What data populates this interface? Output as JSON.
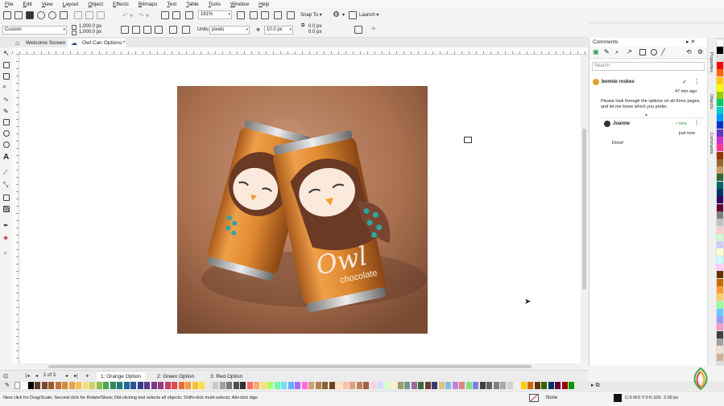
{
  "menu": [
    "File",
    "Edit",
    "View",
    "Layout",
    "Object",
    "Effects",
    "Bitmaps",
    "Text",
    "Table",
    "Tools",
    "Window",
    "Help"
  ],
  "toolbar": {
    "zoom": "161%",
    "snap_to": "Snap To",
    "launch": "Launch"
  },
  "propbar": {
    "preset": "Custom",
    "width": "1,000.0 px",
    "height": "1,000.0 px",
    "units_label": "Units:",
    "units": "pixels",
    "nudge": "10.0 px",
    "dup_x": "0.0 px",
    "dup_y": "0.0 px"
  },
  "doc_tabs": [
    {
      "label": "Welcome Screen",
      "icon": "home-icon",
      "active": false
    },
    {
      "label": "Owl Can Options.*",
      "icon": "doc-icon",
      "active": true
    }
  ],
  "page_nav": {
    "counter": "1 of 3",
    "pages": [
      "1: Orange Option",
      "2: Green Option",
      "3: Red Option"
    ],
    "active_index": 0
  },
  "comments_panel": {
    "title": "Comments",
    "search_placeholder": "Search",
    "thread": {
      "author": "bonnie roskes",
      "time": "47 min ago",
      "body": "Please look through the options on all three pages, and let me know which you prefer.",
      "reply": {
        "author": "Joanne",
        "badge": "• new",
        "time": "just now",
        "body": "Done!"
      }
    }
  },
  "side_tabs": [
    "Properties",
    "Objects",
    "Comments"
  ],
  "status": {
    "hint": "Next click for Drag/Scale; Second click for Rotate/Skew; Dbl-clicking tool selects all objects; Shift+click multi-selects; Alt+click digs",
    "fill": "None",
    "outline_color": "C:0 M:0 Y:0 K:100",
    "outline_width": "2.00 px"
  },
  "artwork": {
    "brand_script": "Owl",
    "brand_word": "chocolate",
    "background_color": "#b47c5c",
    "can_color": "#d9852a"
  },
  "palette_colors": [
    "#ffffff",
    "#000000",
    "#5a3a26",
    "#7a4a2e",
    "#9a5d32",
    "#c0753a",
    "#d68a3c",
    "#e5a44c",
    "#f0c25a",
    "#f7dc7a",
    "#c8d45a",
    "#8fbf4a",
    "#4aa84a",
    "#2e8a5a",
    "#1d7a7a",
    "#1b6a9a",
    "#2c4f9a",
    "#3a3a8a",
    "#5a3a8a",
    "#7a3a8a",
    "#9a3a7a",
    "#c0406a",
    "#e04a4a",
    "#f06a3a",
    "#f49a3a",
    "#f7c03a",
    "#ffe03a",
    "#e8e8e8",
    "#c8c8c8",
    "#a0a0a0",
    "#787878",
    "#505050",
    "#303030",
    "#ff6a6a",
    "#ffaa6a",
    "#ffe06a",
    "#aaff6a",
    "#6affaa",
    "#6ae0ff",
    "#6aaaff",
    "#aa6aff",
    "#ff6ae0",
    "#d0a070",
    "#b08050",
    "#906030",
    "#704020",
    "#ffe0c0",
    "#ffc0a0",
    "#e0a080",
    "#c08060",
    "#a06040",
    "#ffd0e0",
    "#d0e0ff",
    "#d0ffd0",
    "#fff0c0",
    "#9a9a6a",
    "#6a9a9a",
    "#9a6a9a",
    "#3a6a3a",
    "#6a3a3a",
    "#3a3a6a",
    "#e0c080",
    "#80c0e0",
    "#c080e0",
    "#e08080",
    "#80e080",
    "#8080e0",
    "#404040",
    "#606060",
    "#808080",
    "#a8a8a8",
    "#d0d0d0",
    "#f0f0f0",
    "#ffcc00",
    "#cc6600",
    "#663300",
    "#336600",
    "#003366",
    "#660033",
    "#990000",
    "#009900"
  ],
  "side_palette": [
    "#ffffff",
    "#000000",
    "#e0e0e0",
    "#ff0000",
    "#ff6600",
    "#ffcc00",
    "#ffff00",
    "#99cc00",
    "#00cc66",
    "#00cccc",
    "#0099ff",
    "#0033cc",
    "#6633cc",
    "#cc33cc",
    "#ff3399",
    "#993300",
    "#996633",
    "#cc9966",
    "#336633",
    "#006666",
    "#003366",
    "#330066",
    "#660033",
    "#808080",
    "#c0c0c0",
    "#ffcccc",
    "#ccffcc",
    "#ccccff",
    "#ffffcc",
    "#ccffff",
    "#ffccff",
    "#663300",
    "#cc6600",
    "#ff9933",
    "#ffcc66",
    "#99ff99",
    "#66ccff",
    "#9999ff",
    "#ff99cc",
    "#404040",
    "#a0a0a0",
    "#f0e0d0",
    "#d0b090"
  ]
}
